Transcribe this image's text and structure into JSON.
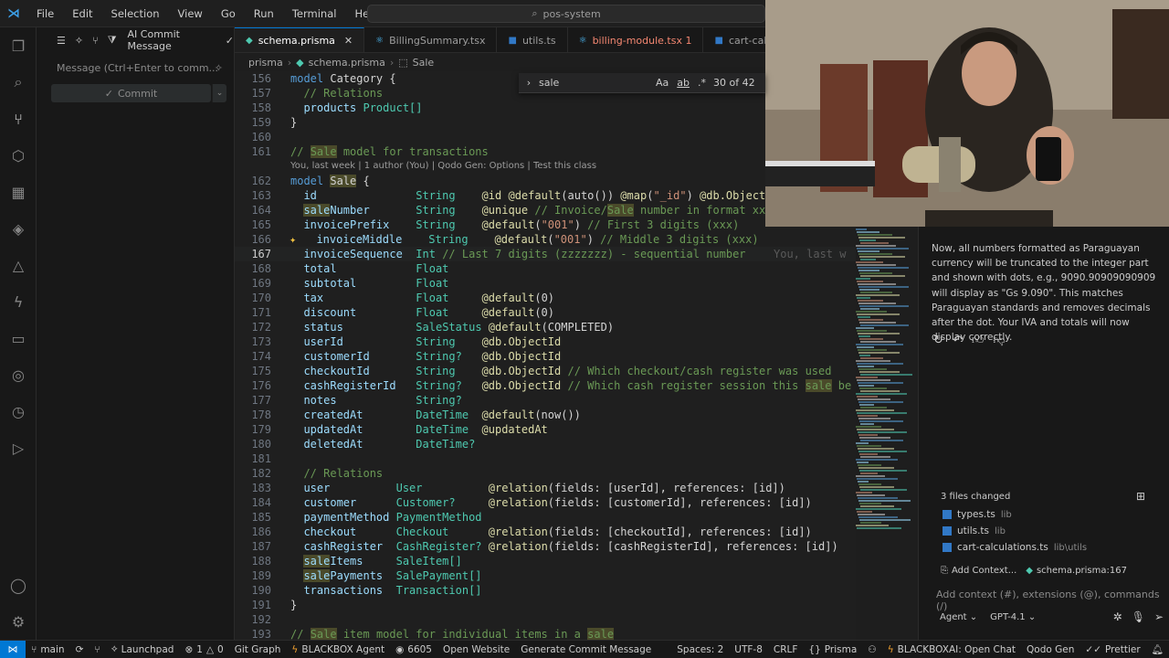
{
  "window": {
    "search_text": "pos-system",
    "menu": [
      "File",
      "Edit",
      "Selection",
      "View",
      "Go",
      "Run",
      "Terminal",
      "Help"
    ]
  },
  "source_control": {
    "ai_commit_label": "AI Commit Message",
    "message_placeholder": "Message (Ctrl+Enter to comm...",
    "commit_label": "Commit"
  },
  "tabs": [
    {
      "label": "schema.prisma",
      "active": true,
      "icon_color": "#4ec9b0"
    },
    {
      "label": "BillingSummary.tsx",
      "active": false,
      "icon_color": "#4fc1ff"
    },
    {
      "label": "utils.ts",
      "active": false,
      "icon_color": "#3178c6"
    },
    {
      "label": "billing-module.tsx 1",
      "active": false,
      "icon_color": "#4fc1ff",
      "error": true
    },
    {
      "label": "cart-calcu",
      "active": false,
      "icon_color": "#3178c6"
    }
  ],
  "breadcrumbs": [
    "prisma",
    "schema.prisma",
    "Sale"
  ],
  "find": {
    "query": "sale",
    "opt_case": "Aa",
    "opt_word": "ab",
    "opt_regex": ".*",
    "count": "30 of 42"
  },
  "editor": {
    "codelens": "You, last week | 1 author (You) | Qodo Gen: Options | Test this class",
    "blame": "You, last w",
    "lines": [
      {
        "n": "156",
        "text": "model Category {"
      },
      {
        "n": "157",
        "text": "  // Relations"
      },
      {
        "n": "158",
        "text": "  products Product[]"
      },
      {
        "n": "159",
        "text": "}"
      },
      {
        "n": "160",
        "text": ""
      },
      {
        "n": "161",
        "text": "// Sale model for transactions"
      },
      {
        "n": "162",
        "text": "model Sale {"
      },
      {
        "n": "163",
        "text": "  id               String    @id @default(auto()) @map(\"_id\") @db.ObjectI"
      },
      {
        "n": "164",
        "text": "  saleNumber       String    @unique // Invoice/Sale number in format xxx"
      },
      {
        "n": "165",
        "text": "  invoicePrefix    String    @default(\"001\") // First 3 digits (xxx)"
      },
      {
        "n": "166",
        "text": "  invoiceMiddle    String    @default(\"001\") // Middle 3 digits (xxx)"
      },
      {
        "n": "167",
        "text": "  invoiceSequence  Int // Last 7 digits (zzzzzzz) - sequential number"
      },
      {
        "n": "168",
        "text": "  total            Float"
      },
      {
        "n": "169",
        "text": "  subtotal         Float"
      },
      {
        "n": "170",
        "text": "  tax              Float     @default(0)"
      },
      {
        "n": "171",
        "text": "  discount         Float     @default(0)"
      },
      {
        "n": "172",
        "text": "  status           SaleStatus @default(COMPLETED)"
      },
      {
        "n": "173",
        "text": "  userId           String    @db.ObjectId"
      },
      {
        "n": "174",
        "text": "  customerId       String?   @db.ObjectId"
      },
      {
        "n": "175",
        "text": "  checkoutId       String    @db.ObjectId // Which checkout/cash register was used"
      },
      {
        "n": "176",
        "text": "  cashRegisterId   String?   @db.ObjectId // Which cash register session this sale be"
      },
      {
        "n": "177",
        "text": "  notes            String?"
      },
      {
        "n": "178",
        "text": "  createdAt        DateTime  @default(now())"
      },
      {
        "n": "179",
        "text": "  updatedAt        DateTime  @updatedAt"
      },
      {
        "n": "180",
        "text": "  deletedAt        DateTime?"
      },
      {
        "n": "181",
        "text": ""
      },
      {
        "n": "182",
        "text": "  // Relations"
      },
      {
        "n": "183",
        "text": "  user          User          @relation(fields: [userId], references: [id])"
      },
      {
        "n": "184",
        "text": "  customer      Customer?     @relation(fields: [customerId], references: [id])"
      },
      {
        "n": "185",
        "text": "  paymentMethod PaymentMethod"
      },
      {
        "n": "186",
        "text": "  checkout      Checkout      @relation(fields: [checkoutId], references: [id])"
      },
      {
        "n": "187",
        "text": "  cashRegister  CashRegister? @relation(fields: [cashRegisterId], references: [id])"
      },
      {
        "n": "188",
        "text": "  saleItems     SaleItem[]"
      },
      {
        "n": "189",
        "text": "  salePayments  SalePayment[]"
      },
      {
        "n": "190",
        "text": "  transactions  Transaction[]"
      },
      {
        "n": "191",
        "text": "}"
      },
      {
        "n": "192",
        "text": ""
      },
      {
        "n": "193",
        "text": "// Sale item model for individual items in a sale"
      }
    ]
  },
  "chat": {
    "message": "Now, all numbers formatted as Paraguayan currency will be truncated to the integer part and shown with dots, e.g., 9090.90909090909 will display as \"Gs 9.090\". This matches Paraguayan standards and removes decimals after the dot. Your IVA and totals will now display correctly.",
    "files_changed": "3 files changed",
    "files": [
      {
        "name": "types.ts",
        "dir": "lib"
      },
      {
        "name": "utils.ts",
        "dir": "lib"
      },
      {
        "name": "cart-calculations.ts",
        "dir": "lib\\utils"
      }
    ],
    "add_context": "Add Context...",
    "context_file": "schema.prisma:167",
    "input_placeholder": "Add context (#), extensions (@), commands (/)",
    "mode": "Agent",
    "model": "GPT-4.1"
  },
  "status": {
    "branch": "main",
    "launchpad": "Launchpad",
    "errors": "1",
    "warnings": "0",
    "git_graph": "Git Graph",
    "blackbox": "BLACKBOX Agent",
    "port": "6605",
    "open_website": "Open Website",
    "gen_commit": "Generate Commit Message",
    "spaces": "Spaces: 2",
    "encoding": "UTF-8",
    "eol": "CRLF",
    "language": "Prisma",
    "blackbox_chat": "BLACKBOXAI: Open Chat",
    "qodo": "Qodo Gen",
    "prettier": "Prettier"
  }
}
